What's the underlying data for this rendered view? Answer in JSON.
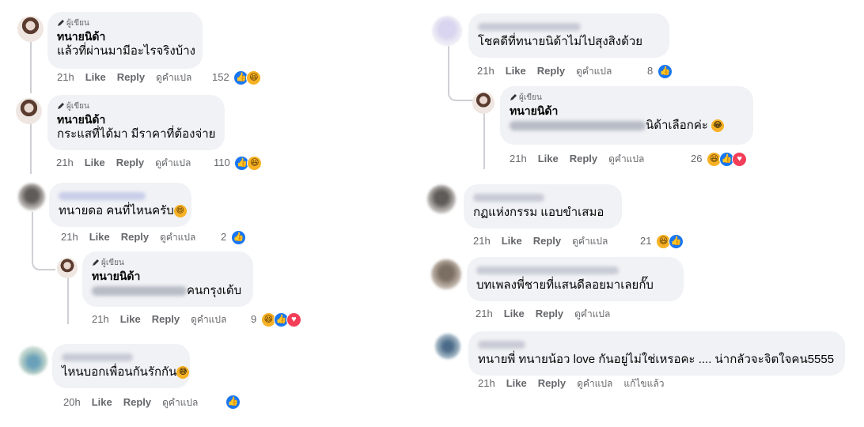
{
  "author_badge": "ผู้เขียน",
  "actions": {
    "like": "Like",
    "reply": "Reply",
    "translate": "ดูคำแปล",
    "edited": "แก้ไขแล้ว"
  },
  "author_name": "ทนายนิด้า",
  "left": [
    {
      "text": "แล้วที่ผ่านมามีอะไรจริงบ้าง",
      "time": "21h",
      "count": "152"
    },
    {
      "text": "กระแสที่ได้มา มีราคาที่ต้องจ่าย",
      "time": "21h",
      "count": "110"
    },
    {
      "text": "ทนายดอ คนที่ไหนครับ",
      "time": "21h",
      "count": "2"
    },
    {
      "text_visible": "คนกรุงเด้บ",
      "time": "21h",
      "count": "9"
    },
    {
      "text": "ไหนบอกเพื่อนกันรักกัน",
      "time": "20h",
      "count": ""
    }
  ],
  "right": [
    {
      "text": "โชคดีที่ทนายนิด้าไม่ไปสุงสิงด้วย",
      "time": "21h",
      "count": "8"
    },
    {
      "text_visible": "นิด้าเลือกค่ะ",
      "time": "21h",
      "count": "26"
    },
    {
      "text": "กฏแห่งกรรม แอบขำเสมอ",
      "time": "21h",
      "count": "21"
    },
    {
      "text": "บทเพลงพี่ชายที่แสนดีลอยมาเลยกั๊บ",
      "time": "21h",
      "count": ""
    },
    {
      "text": "ทนายพี่ ทนายน้อว love กันอยู่ไม่ใช่เหรอคะ .... น่ากลัวจะจิตใจคน5555",
      "time": "21h",
      "count": ""
    }
  ],
  "colors": {
    "like": "#1877f2",
    "haha": "#f7b125",
    "love": "#f33e58",
    "bubble": "#f0f2f5",
    "meta": "#65676b"
  }
}
